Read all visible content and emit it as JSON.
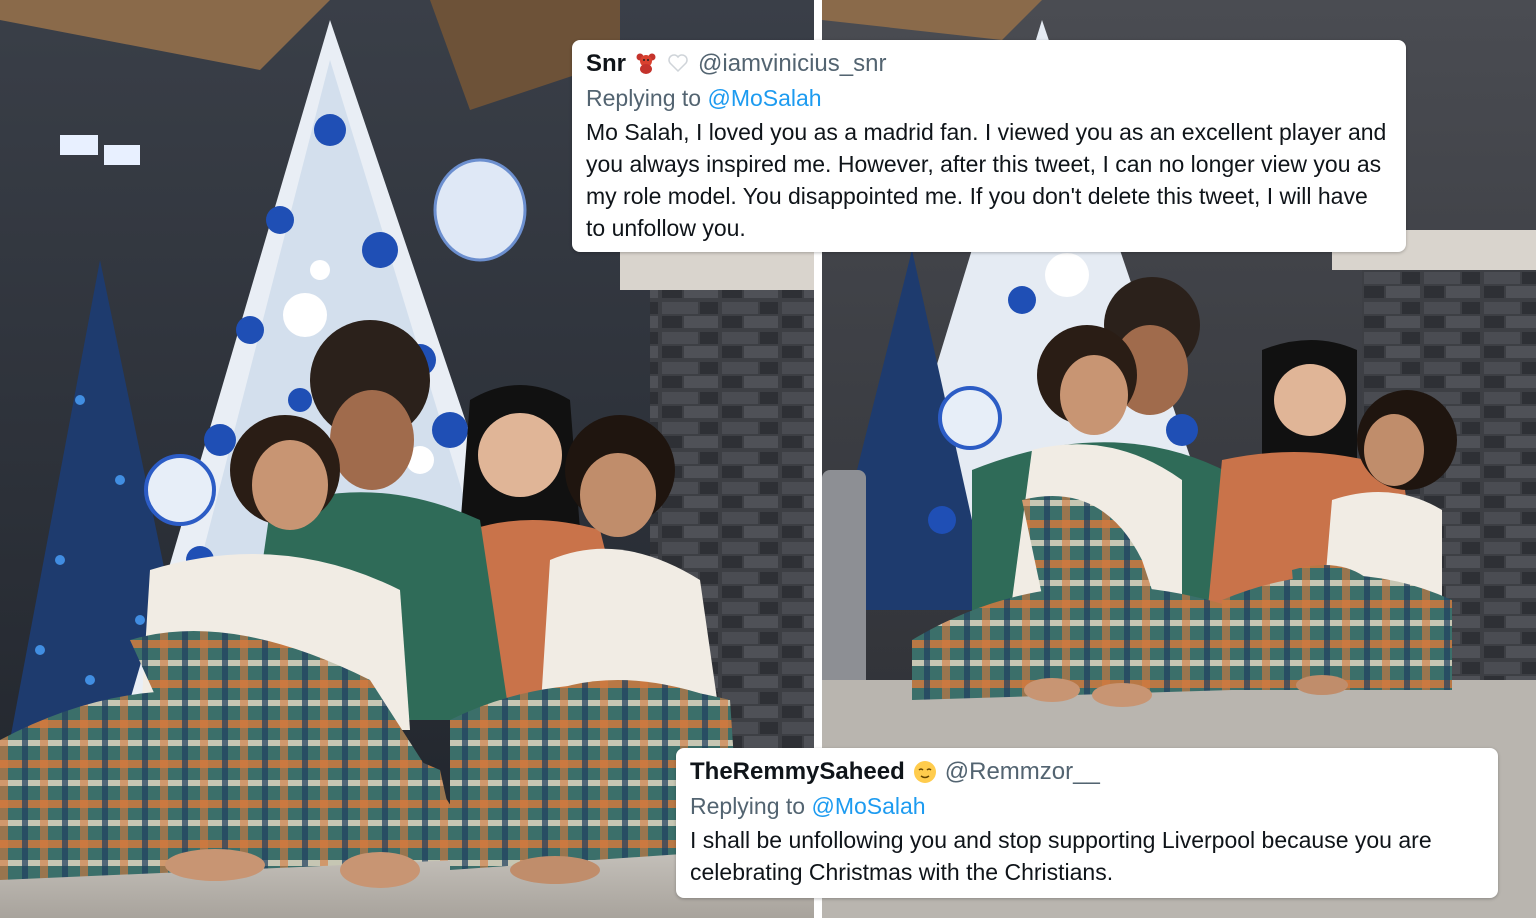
{
  "tweets": {
    "top": {
      "display_name": "Snr",
      "name_emojis": [
        "teddy-bear-emoji",
        "white-heart-emoji"
      ],
      "handle": "@iamvinicius_snr",
      "replying_prefix": "Replying to",
      "replying_to": "@MoSalah",
      "text": "Mo Salah, I loved you as a madrid fan. I viewed you as an excellent player and you always inspired me. However, after this tweet, I can no longer view you as my role model. You disappointed me. If you don't delete this tweet, I will have to unfollow you."
    },
    "bottom": {
      "display_name": "TheRemmySaheed",
      "name_emojis": [
        "relieved-face-emoji"
      ],
      "handle": "@Remmzor__",
      "replying_prefix": "Replying to",
      "replying_to": "@MoSalah",
      "text": "I shall be unfollowing you and stop supporting Liverpool because you are celebrating Christmas with the Christians."
    }
  },
  "colors": {
    "mention_blue": "#1d9bf0",
    "handle_grey": "#536471",
    "tree_blue": "#2c5cc5",
    "plaid_green": "#2f6b58",
    "plaid_orange": "#d77a3c"
  }
}
